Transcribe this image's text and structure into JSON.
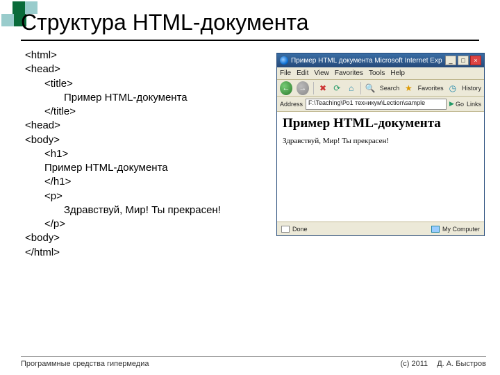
{
  "slide": {
    "title": "Структура HTML-документа"
  },
  "code": {
    "l1": "<html>",
    "l2": "<head>",
    "l3": "<title>",
    "l4": "Пример HTML-документа",
    "l5": "</title>",
    "l6": "<head>",
    "l7": "<body>",
    "l8": "<h1>",
    "l9": "Пример HTML-документа",
    "l10": "</h1>",
    "l11": "<p>",
    "l12": "Здравствуй, Мир! Ты прекрасен!",
    "l13": "</p>",
    "l14": "<body>",
    "l15": "</html>"
  },
  "footer": {
    "left": "Программные средства гипермедиа",
    "copyright": "(с) 2011",
    "author": "Д. А. Быстров"
  },
  "browser": {
    "title": "Пример HTML документа    Microsoft Internet Explorer",
    "menu": {
      "file": "File",
      "edit": "Edit",
      "view": "View",
      "favorites": "Favorites",
      "tools": "Tools",
      "help": "Help"
    },
    "toolbar": {
      "search": "Search",
      "favorites": "Favorites",
      "history": "History"
    },
    "address_label": "Address",
    "address_value": "F:\\Teaching\\Ро1 техникум\\Lection\\sample",
    "go": "Go",
    "links": "Links",
    "page_h1": "Пример HTML-документа",
    "page_p": "Здравствуй, Мир! Ты прекрасен!",
    "status_done": "Done",
    "status_zone": "My Computer",
    "winbtn_min": "_",
    "winbtn_max": "□",
    "winbtn_close": "×"
  }
}
